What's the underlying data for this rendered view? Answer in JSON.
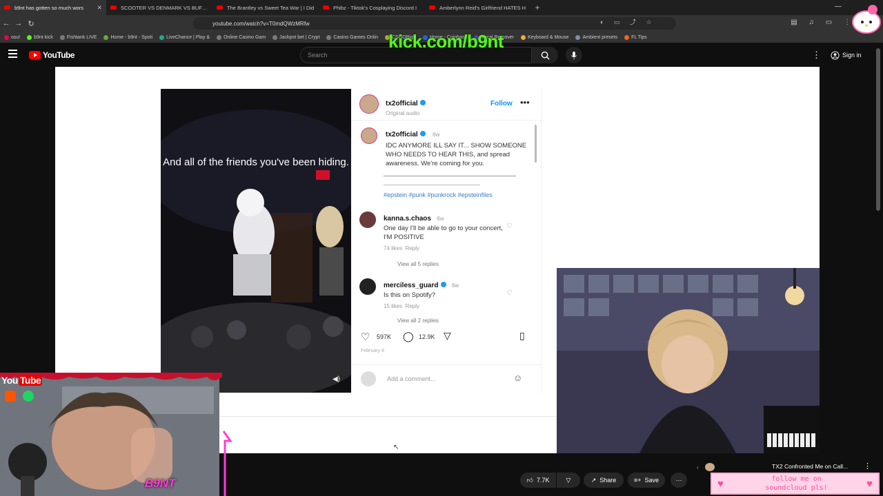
{
  "browser": {
    "tabs": [
      {
        "label": "b9nt has gotten so much wors",
        "active": true
      },
      {
        "label": "SCOOTER VS DENMARK VS BUFF - Yo",
        "active": false
      },
      {
        "label": "The Brantley vs Sweet Tea War | I Did",
        "active": false
      },
      {
        "label": "Phibz - Tiktok's Cosplaying Discord I",
        "active": false
      },
      {
        "label": "Amberlynn Reid's Girlfriend HATES H",
        "active": false
      }
    ],
    "new_tab": "+",
    "url": "youtube.com/watch?v=T0mdQWzMRfw",
    "bookmarks": [
      "b9nt kick",
      "Fishtank LIVE",
      "Home - b9nt - Spoti",
      "LiveChance | Play &",
      "Online Casino Gam",
      "Jackpot bet | Crypt",
      "Casino Games Onlin",
      "CSGOBig -",
      "Home - Coinbase",
      "Vocal Remover",
      "Keyboard & Mouse",
      "Ambient presets",
      "FL Tips"
    ],
    "bookmark_prefix": "osu!"
  },
  "overlay": {
    "kick_url": "kick.com/b9nt",
    "yt_brand": "You",
    "yt_brand_tube": "Tube",
    "b9nt_tag": "B9NT",
    "soundcloud_line1": "follow me on",
    "soundcloud_line2": "soundcloud pls!"
  },
  "youtube": {
    "logo_text": "YouTube",
    "search_placeholder": "Search",
    "sign_in": "Sign in",
    "like_count": "7.7K",
    "share_label": "Share",
    "save_label": "Save",
    "next_video_title": "TX2 Confronted Me on Call..."
  },
  "instagram": {
    "username": "tx2official",
    "audio_label": "Original audio",
    "follow_label": "Follow",
    "caption_overlay": "And all of the friends you've been hiding.",
    "post_time": "6w",
    "post_text": "IDC ANYMORE ILL SAY IT... SHOW SOMEONE WHO NEEDS TO HEAR THIS, and spread awareness. We're coming for you.",
    "hashtags": "#epstein #punk #punkrock #epsteinfiles",
    "comments": [
      {
        "user": "kanna.s.chaos",
        "time": "6w",
        "text": "One day I'll be able to go to your concert, I'M POSITIVE",
        "likes": "74 likes",
        "reply": "Reply",
        "view_replies": "View all 5 replies"
      },
      {
        "user": "merciless_guard",
        "time": "6w",
        "text": "Is this on Spotify?",
        "likes": "15 likes",
        "reply": "Reply",
        "view_replies": "View all 2 replies"
      }
    ],
    "likes": "597K",
    "comments_count": "12.9K",
    "date": "February 8",
    "add_comment_placeholder": "Add a comment..."
  },
  "colors": {
    "kick_green": "#53fc18",
    "youtube_red": "#ff0000",
    "instagram_link": "#3a7cc9",
    "follow_blue": "#0095f6"
  }
}
